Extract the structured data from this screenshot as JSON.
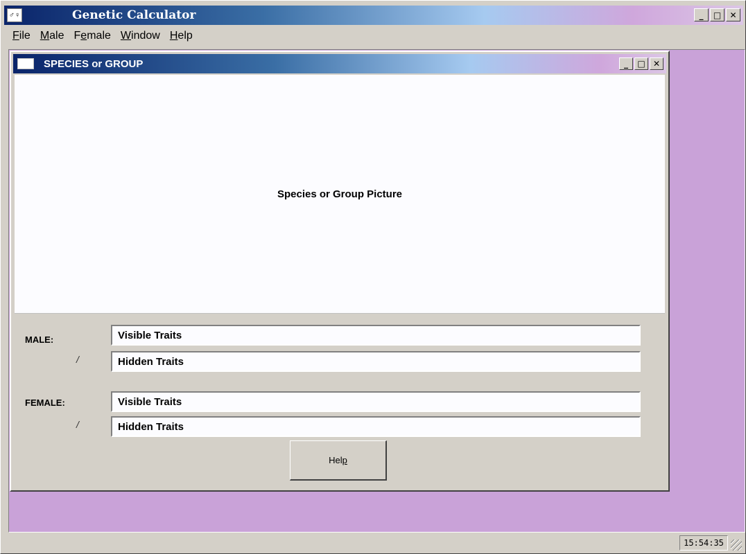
{
  "app": {
    "icon_glyph": "♂♀",
    "title": "Genetic Calculator",
    "window_buttons": {
      "minimize": "_",
      "maximize": "□",
      "close": "✕"
    }
  },
  "menu": [
    {
      "label": "File",
      "underline_index": 0
    },
    {
      "label": "Male",
      "underline_index": 0
    },
    {
      "label": "Female",
      "underline_index": 1
    },
    {
      "label": "Window",
      "underline_index": 0
    },
    {
      "label": "Help",
      "underline_index": 0
    }
  ],
  "child_window": {
    "title": "SPECIES or GROUP",
    "window_buttons": {
      "minimize": "_",
      "maximize": "□",
      "close": "✕"
    },
    "picture_label": "Species or Group Picture",
    "male": {
      "label": "MALE:",
      "slash": "/",
      "visible_traits": "Visible Traits",
      "hidden_traits": "Hidden Traits"
    },
    "female": {
      "label": "FEMALE:",
      "slash": "/",
      "visible_traits": "Visible Traits",
      "hidden_traits": "Hidden Traits"
    },
    "help_button": {
      "label": "Help",
      "underline_index": 3
    }
  },
  "status_bar": {
    "clock": "15:54:35"
  },
  "colors": {
    "mdi_background": "#c9a2d8",
    "title_gradient_start": "#0a246a",
    "title_gradient_end": "#dcc6e6",
    "face": "#d4d0c8"
  }
}
